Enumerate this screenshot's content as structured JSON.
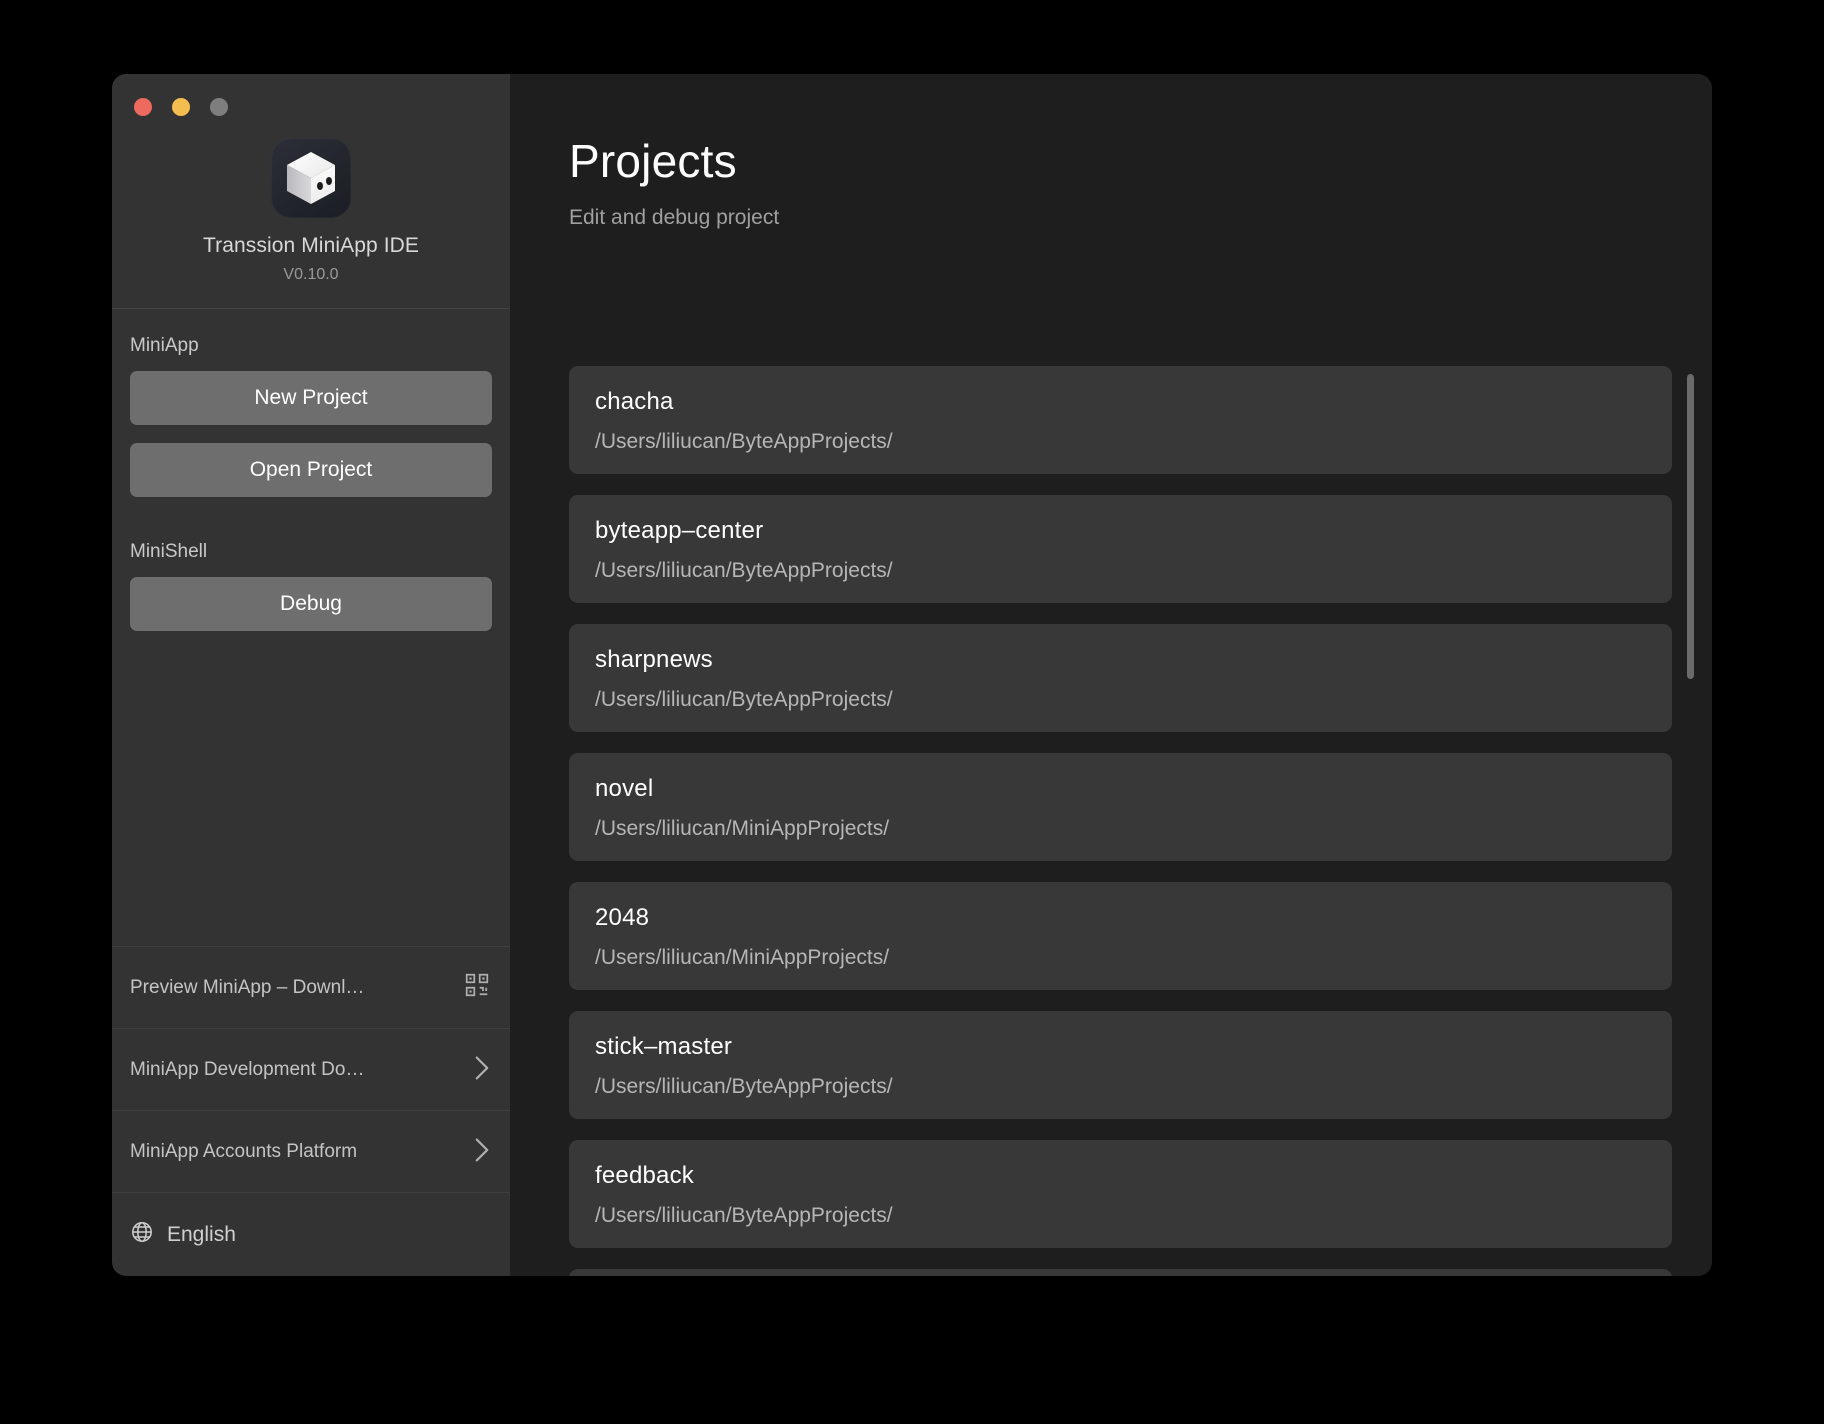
{
  "window": {
    "traffic_lights": [
      {
        "name": "close",
        "color": "#EC6A5E"
      },
      {
        "name": "minimize",
        "color": "#F4BD4F"
      },
      {
        "name": "maximize",
        "color": "#7E7E7E"
      }
    ]
  },
  "sidebar": {
    "app_icon": "cube-app-icon",
    "app_name": "Transsion MiniApp IDE",
    "app_version": "V0.10.0",
    "sections": [
      {
        "label": "MiniApp",
        "buttons": [
          {
            "name": "new-project",
            "label": "New Project"
          },
          {
            "name": "open-project",
            "label": "Open Project"
          }
        ]
      },
      {
        "label": "MiniShell",
        "buttons": [
          {
            "name": "debug",
            "label": "Debug"
          }
        ]
      }
    ],
    "links": [
      {
        "name": "preview-miniapp-download",
        "label": "Preview MiniApp – Downl…",
        "trailing_icon": "qr-code-icon"
      },
      {
        "name": "miniapp-development-docs",
        "label": "MiniApp Development Do…",
        "trailing_icon": "chevron-right-icon"
      },
      {
        "name": "miniapp-accounts-platform",
        "label": "MiniApp Accounts Platform",
        "trailing_icon": "chevron-right-icon"
      }
    ],
    "language": {
      "icon": "globe-icon",
      "label": "English"
    }
  },
  "main": {
    "title": "Projects",
    "subtitle": "Edit and debug project",
    "projects": [
      {
        "name": "chacha",
        "path": "/Users/liliucan/ByteAppProjects/"
      },
      {
        "name": "byteapp–center",
        "path": "/Users/liliucan/ByteAppProjects/"
      },
      {
        "name": "sharpnews",
        "path": "/Users/liliucan/ByteAppProjects/"
      },
      {
        "name": "novel",
        "path": "/Users/liliucan/MiniAppProjects/"
      },
      {
        "name": "2048",
        "path": "/Users/liliucan/MiniAppProjects/"
      },
      {
        "name": "stick–master",
        "path": "/Users/liliucan/ByteAppProjects/"
      },
      {
        "name": "feedback",
        "path": "/Users/liliucan/ByteAppProjects/"
      },
      {
        "name": "",
        "path": ""
      }
    ]
  },
  "colors": {
    "sidebar_bg": "#333333",
    "main_bg": "#1e1e1e",
    "card_bg": "#383838",
    "button_bg": "#6e6e6e",
    "scrollbar": "#6a6a6a"
  }
}
